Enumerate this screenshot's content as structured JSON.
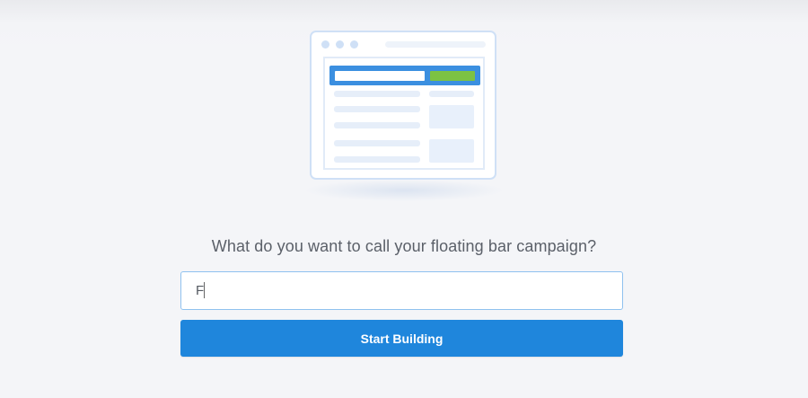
{
  "form": {
    "question": "What do you want to call your floating bar campaign?",
    "campaign_name_value": "F",
    "start_button_label": "Start Building"
  },
  "illustration": {
    "icon": "floating-bar-illustration",
    "colors": {
      "frame": "#cfe0f6",
      "bar": "#3b8fe0",
      "bar_button": "#7cc243"
    }
  },
  "colors": {
    "primary_button": "#1f86dc",
    "input_border": "#8fc1ef",
    "question_text": "#5b6069",
    "background": "#f4f5f8"
  }
}
